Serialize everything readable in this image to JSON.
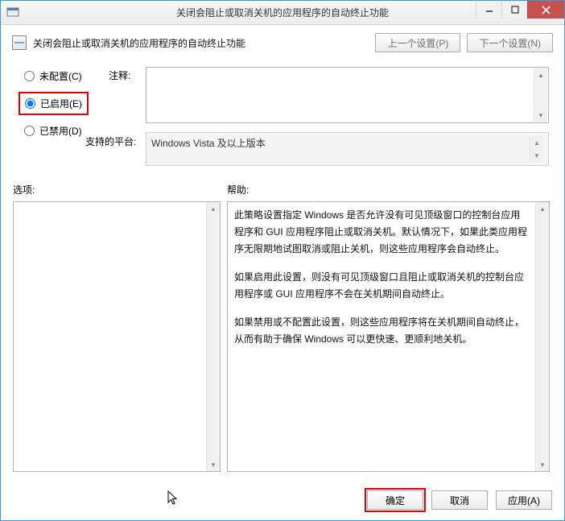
{
  "window": {
    "title": "关闭会阻止或取消关机的应用程序的自动终止功能"
  },
  "header": {
    "text": "关闭会阻止或取消关机的应用程序的自动终止功能",
    "prev_setting": "上一个设置(P)",
    "next_setting": "下一个设置(N)"
  },
  "radios": {
    "not_configured": "未配置(C)",
    "enabled": "已启用(E)",
    "disabled": "已禁用(D)"
  },
  "labels": {
    "comment": "注释:",
    "platform": "支持的平台:",
    "options": "选项:",
    "help": "帮助:"
  },
  "platform_text": "Windows Vista 及以上版本",
  "help": {
    "p1": "此策略设置指定 Windows 是否允许没有可见顶级窗口的控制台应用程序和 GUI 应用程序阻止或取消关机。默认情况下，如果此类应用程序无限期地试图取消或阻止关机，则这些应用程序会自动终止。",
    "p2": "如果启用此设置，则没有可见顶级窗口且阻止或取消关机的控制台应用程序或 GUI 应用程序不会在关机期间自动终止。",
    "p3": "如果禁用或不配置此设置，则这些应用程序将在关机期间自动终止，从而有助于确保 Windows 可以更快速、更顺利地关机。"
  },
  "footer": {
    "ok": "确定",
    "cancel": "取消",
    "apply": "应用(A)"
  }
}
